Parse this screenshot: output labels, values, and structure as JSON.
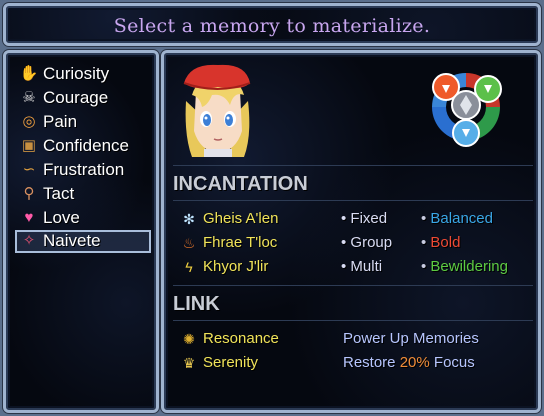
{
  "help": {
    "text": "Select a memory to materialize."
  },
  "memories": [
    {
      "label": "Curiosity",
      "icon": "curiosity-icon",
      "glyph": "✋"
    },
    {
      "label": "Courage",
      "icon": "courage-icon",
      "glyph": "☠"
    },
    {
      "label": "Pain",
      "icon": "pain-icon",
      "glyph": "◎"
    },
    {
      "label": "Confidence",
      "icon": "confidence-icon",
      "glyph": "▣"
    },
    {
      "label": "Frustration",
      "icon": "frustration-icon",
      "glyph": "∽"
    },
    {
      "label": "Tact",
      "icon": "tact-icon",
      "glyph": "⚲"
    },
    {
      "label": "Love",
      "icon": "love-icon",
      "glyph": "♥"
    },
    {
      "label": "Naivete",
      "icon": "naivete-icon",
      "glyph": "✧"
    }
  ],
  "selected_index": 7,
  "incantation": {
    "header": "INCANTATION",
    "rows": [
      {
        "name": "Gheis A'len",
        "type": "Fixed",
        "effect": "Balanced",
        "effect_color": "#3aa6e6",
        "icon": "ice-crystal-icon"
      },
      {
        "name": "Fhrae T'loc",
        "type": "Group",
        "effect": "Bold",
        "effect_color": "#ee4a34",
        "icon": "fire-icon"
      },
      {
        "name": "Khyor J'lir",
        "type": "Multi",
        "effect": "Bewildering",
        "effect_color": "#5dcb43",
        "icon": "lightning-icon"
      }
    ]
  },
  "link": {
    "header": "LINK",
    "rows": [
      {
        "name": "Resonance",
        "desc": "Power Up Memories",
        "icon": "resonance-icon"
      },
      {
        "name": "Serenity",
        "desc_pre": "Restore ",
        "desc_hl": "20%",
        "desc_post": " Focus",
        "icon": "serenity-icon"
      }
    ]
  },
  "colors": {
    "name": "#f0e35a",
    "help_text": "#c8a6ef",
    "desc": "#b7c6ff",
    "highlight": "#f08c38"
  }
}
